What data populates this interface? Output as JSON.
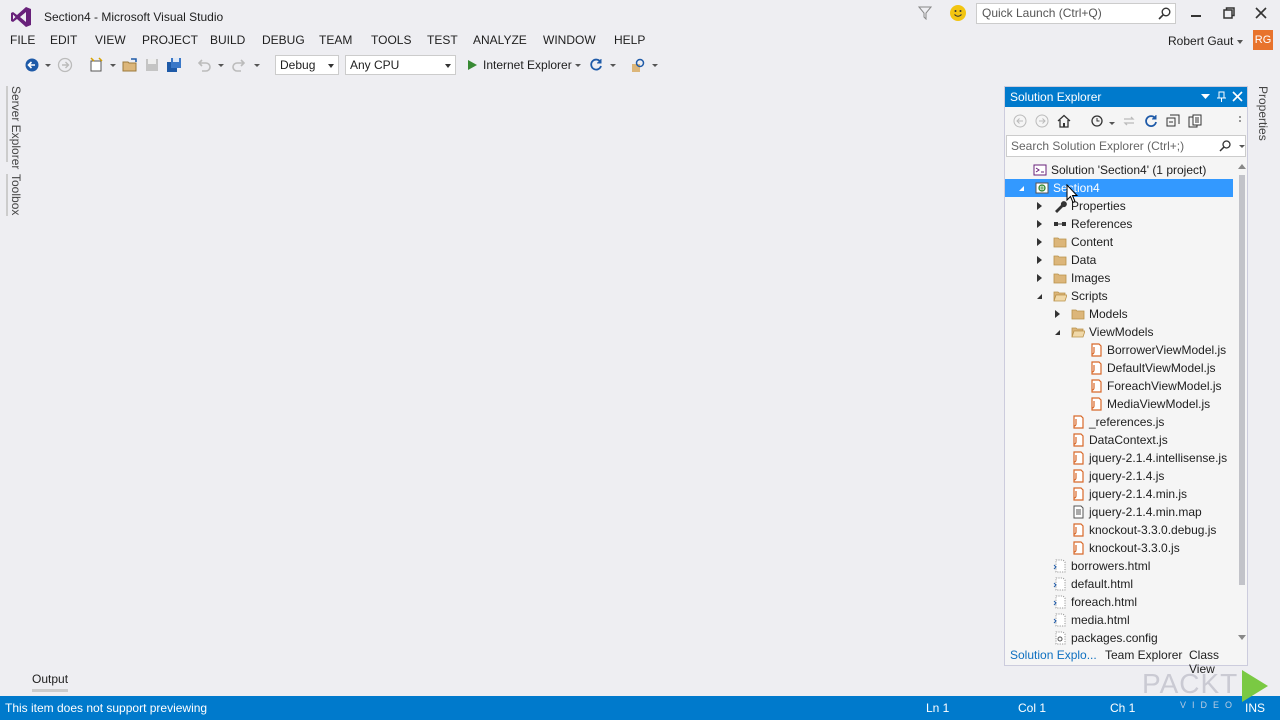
{
  "window": {
    "title": "Section4 - Microsoft Visual Studio",
    "quick_launch_placeholder": "Quick Launch (Ctrl+Q)",
    "user": "Robert Gaut",
    "avatar_initials": "RG"
  },
  "menu": [
    "FILE",
    "EDIT",
    "VIEW",
    "PROJECT",
    "BUILD",
    "DEBUG",
    "TEAM",
    "TOOLS",
    "TEST",
    "ANALYZE",
    "WINDOW",
    "HELP"
  ],
  "toolbar": {
    "configuration": "Debug",
    "platform": "Any CPU",
    "run_target": "Internet Explorer"
  },
  "left_tabs": [
    "Server Explorer",
    "Toolbox"
  ],
  "right_tabs": [
    "Properties"
  ],
  "solution_explorer": {
    "title": "Solution Explorer",
    "search_placeholder": "Search Solution Explorer (Ctrl+;)",
    "tree": [
      {
        "label": "Solution 'Section4' (1 project)",
        "depth": 0,
        "icon": "solution-icon",
        "twisty": "none"
      },
      {
        "label": "Section4",
        "depth": 0,
        "icon": "web-project-icon",
        "twisty": "expanded",
        "selected": true
      },
      {
        "label": "Properties",
        "depth": 1,
        "icon": "wrench-icon",
        "twisty": "collapsed"
      },
      {
        "label": "References",
        "depth": 1,
        "icon": "references-icon",
        "twisty": "collapsed"
      },
      {
        "label": "Content",
        "depth": 1,
        "icon": "folder-icon",
        "twisty": "collapsed"
      },
      {
        "label": "Data",
        "depth": 1,
        "icon": "folder-icon",
        "twisty": "collapsed"
      },
      {
        "label": "Images",
        "depth": 1,
        "icon": "folder-icon",
        "twisty": "collapsed"
      },
      {
        "label": "Scripts",
        "depth": 1,
        "icon": "folder-open-icon",
        "twisty": "expanded"
      },
      {
        "label": "Models",
        "depth": 2,
        "icon": "folder-icon",
        "twisty": "collapsed"
      },
      {
        "label": "ViewModels",
        "depth": 2,
        "icon": "folder-open-icon",
        "twisty": "expanded"
      },
      {
        "label": "BorrowerViewModel.js",
        "depth": 3,
        "icon": "js-file-icon",
        "twisty": "none"
      },
      {
        "label": "DefaultViewModel.js",
        "depth": 3,
        "icon": "js-file-icon",
        "twisty": "none"
      },
      {
        "label": "ForeachViewModel.js",
        "depth": 3,
        "icon": "js-file-icon",
        "twisty": "none"
      },
      {
        "label": "MediaViewModel.js",
        "depth": 3,
        "icon": "js-file-icon",
        "twisty": "none"
      },
      {
        "label": "_references.js",
        "depth": 2,
        "icon": "js-file-icon",
        "twisty": "none"
      },
      {
        "label": "DataContext.js",
        "depth": 2,
        "icon": "js-file-icon",
        "twisty": "none"
      },
      {
        "label": "jquery-2.1.4.intellisense.js",
        "depth": 2,
        "icon": "js-file-icon",
        "twisty": "none"
      },
      {
        "label": "jquery-2.1.4.js",
        "depth": 2,
        "icon": "js-file-icon",
        "twisty": "none"
      },
      {
        "label": "jquery-2.1.4.min.js",
        "depth": 2,
        "icon": "js-file-icon",
        "twisty": "none"
      },
      {
        "label": "jquery-2.1.4.min.map",
        "depth": 2,
        "icon": "map-file-icon",
        "twisty": "none"
      },
      {
        "label": "knockout-3.3.0.debug.js",
        "depth": 2,
        "icon": "js-file-icon",
        "twisty": "none"
      },
      {
        "label": "knockout-3.3.0.js",
        "depth": 2,
        "icon": "js-file-icon",
        "twisty": "none"
      },
      {
        "label": "borrowers.html",
        "depth": 1,
        "icon": "html-file-icon",
        "twisty": "none"
      },
      {
        "label": "default.html",
        "depth": 1,
        "icon": "html-file-icon",
        "twisty": "none"
      },
      {
        "label": "foreach.html",
        "depth": 1,
        "icon": "html-file-icon",
        "twisty": "none"
      },
      {
        "label": "media.html",
        "depth": 1,
        "icon": "html-file-icon",
        "twisty": "none"
      },
      {
        "label": "packages.config",
        "depth": 1,
        "icon": "config-file-icon",
        "twisty": "none"
      }
    ],
    "tabs": [
      "Solution Explo...",
      "Team Explorer",
      "Class View"
    ]
  },
  "output_tab": "Output",
  "status": {
    "message": "This item does not support previewing",
    "ln": "Ln 1",
    "col": "Col 1",
    "ch": "Ch 1",
    "mode": "INS"
  },
  "watermark": {
    "brand": "PACKT",
    "sub": "VIDEO"
  },
  "colors": {
    "accent": "#007acc",
    "selection": "#3399ff",
    "background": "#eeeef2",
    "avatar": "#e8732c",
    "js_file": "#d8692a"
  }
}
